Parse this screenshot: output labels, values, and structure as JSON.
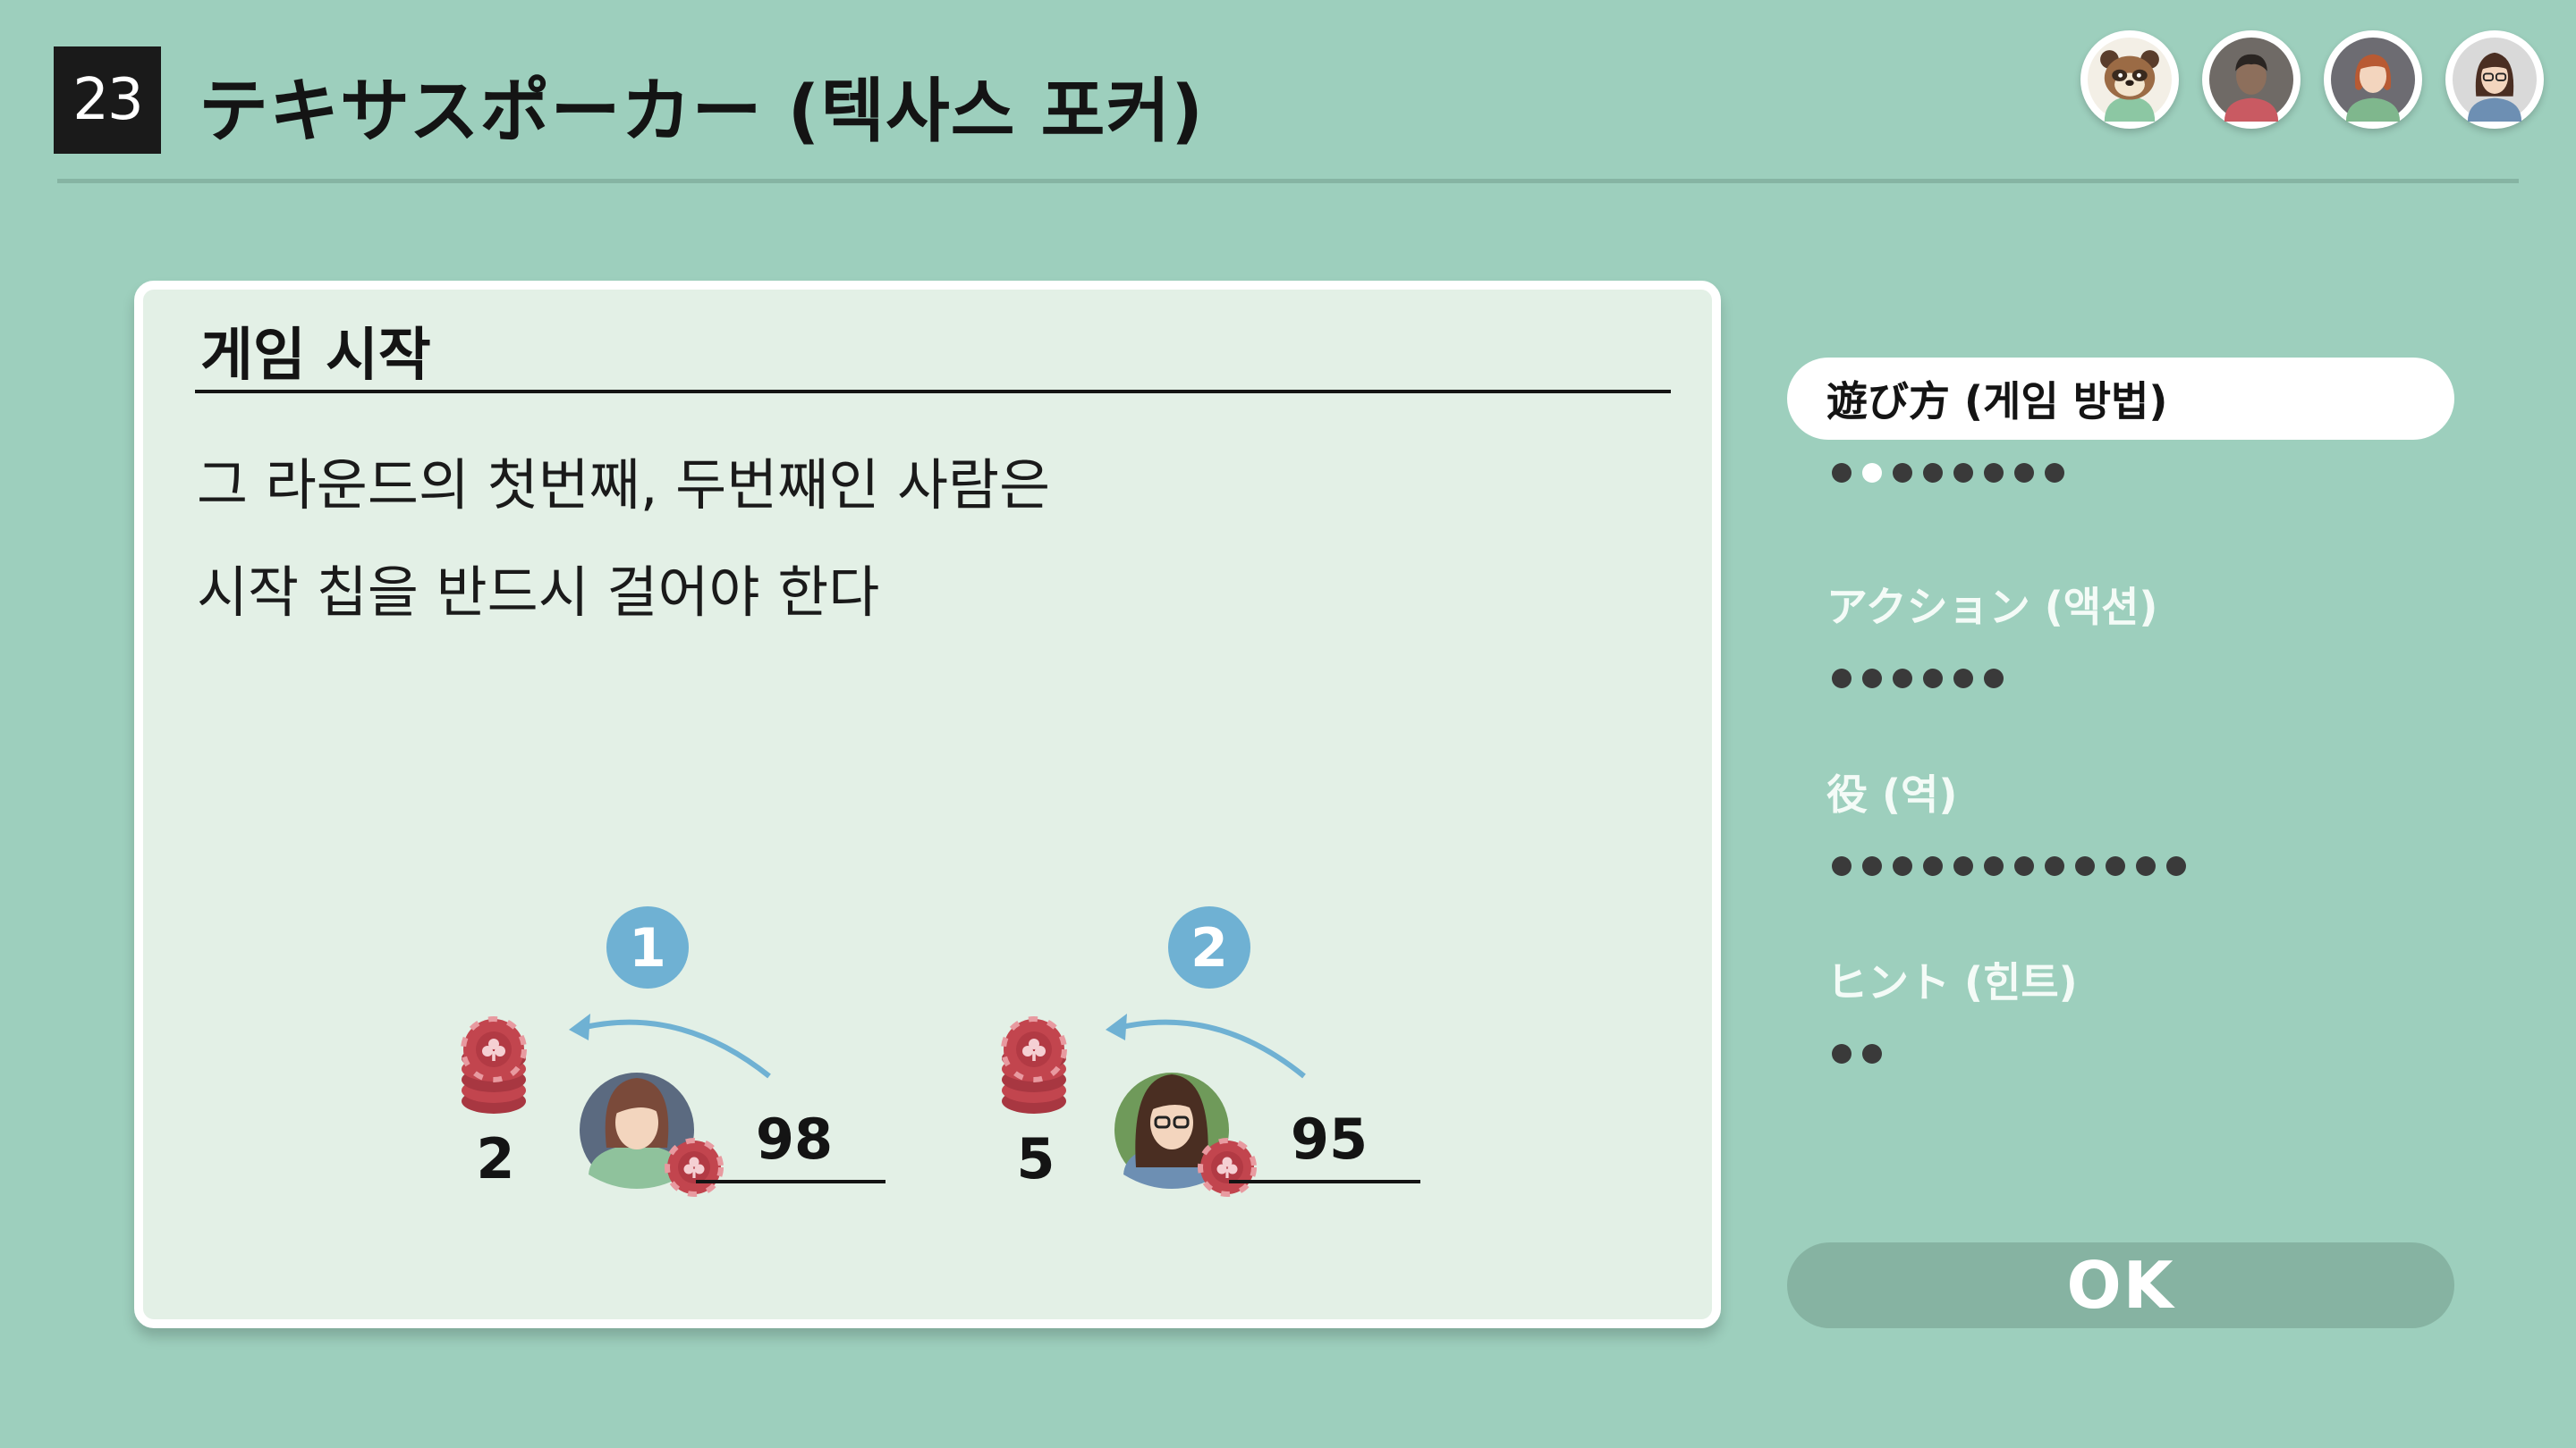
{
  "header": {
    "game_number": "23",
    "title": "テキサスポーカー (텍사스 포커)",
    "players": [
      {
        "icon": "tanuki-villager-avatar-icon"
      },
      {
        "icon": "dark-hair-man-avatar-icon"
      },
      {
        "icon": "red-hair-woman-avatar-icon"
      },
      {
        "icon": "glasses-woman-avatar-icon"
      }
    ]
  },
  "card": {
    "heading": "게임 시작",
    "lines": [
      "그 라운드의 첫번째, 두번째인 사람은",
      "시작 칩을 반드시 걸어야 한다"
    ],
    "illustration": {
      "players": [
        {
          "order": "1",
          "bet": "2",
          "stack": "98"
        },
        {
          "order": "2",
          "bet": "5",
          "stack": "95"
        }
      ]
    }
  },
  "menu": {
    "items": [
      {
        "label": "遊び方 (게임 방법)",
        "pages": 8,
        "current_page": 2,
        "selected": true
      },
      {
        "label": "アクション (액션)",
        "pages": 6,
        "current_page": 0,
        "selected": false
      },
      {
        "label": "役 (역)",
        "pages": 12,
        "current_page": 0,
        "selected": false
      },
      {
        "label": "ヒント (힌트)",
        "pages": 2,
        "current_page": 0,
        "selected": false
      }
    ]
  },
  "ok_label": "OK",
  "colors": {
    "background": "#9dcfbd",
    "card": "#e3f0e6",
    "order_badge": "#6fb1d3",
    "chip": "#c2454e",
    "ok_button": "#86b3a2"
  }
}
